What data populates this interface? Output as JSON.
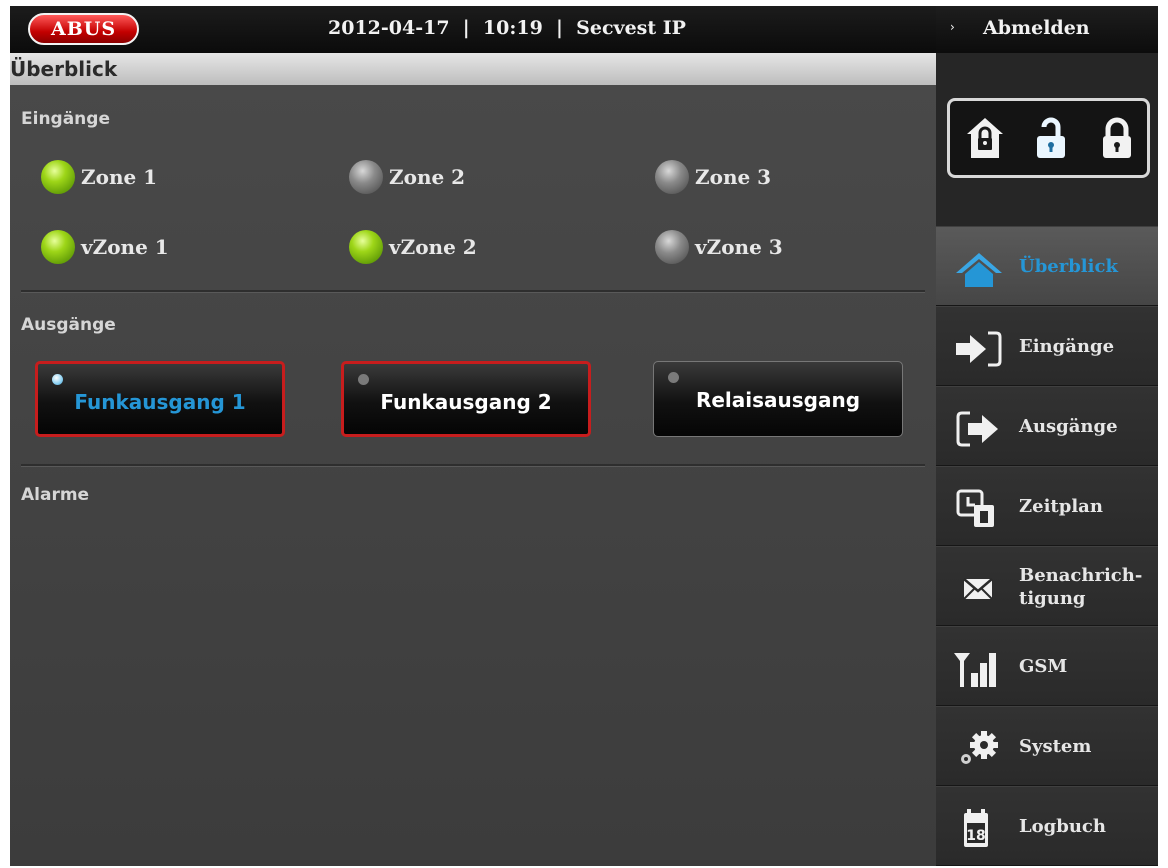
{
  "header": {
    "logo_text": "ABUS",
    "info": "2012-04-17  |  10:19  |  Secvest IP",
    "logout_label": "Abmelden",
    "logout_arrow": "›"
  },
  "page_title": "Überblick",
  "inputs": {
    "title": "Eingänge",
    "zones": [
      {
        "label": "Zone 1",
        "state": "on"
      },
      {
        "label": "Zone 2",
        "state": "off"
      },
      {
        "label": "Zone 3",
        "state": "off"
      },
      {
        "label": "vZone 1",
        "state": "on"
      },
      {
        "label": "vZone 2",
        "state": "on"
      },
      {
        "label": "vZone 3",
        "state": "off"
      }
    ]
  },
  "outputs": {
    "title": "Ausgänge",
    "buttons": [
      {
        "label": "Funkausgang 1",
        "selected": true,
        "active": true
      },
      {
        "label": "Funkausgang 2",
        "selected": true,
        "active": false
      },
      {
        "label": "Relaisausgang",
        "selected": false,
        "active": false
      }
    ]
  },
  "alarms": {
    "title": "Alarme"
  },
  "arm_modes": [
    {
      "name": "home-lock-icon",
      "active": false
    },
    {
      "name": "unlock-icon",
      "active": true
    },
    {
      "name": "lock-icon",
      "active": false
    }
  ],
  "sidebar": {
    "items": [
      {
        "label": "Überblick",
        "icon": "home-icon",
        "active": true
      },
      {
        "label": "Eingänge",
        "icon": "arrow-in-icon",
        "active": false
      },
      {
        "label": "Ausgänge",
        "icon": "arrow-out-icon",
        "active": false
      },
      {
        "label": "Zeitplan",
        "icon": "clock-calendar-icon",
        "active": false
      },
      {
        "label": "Benachrich-\ntigung",
        "icon": "envelope-icon",
        "active": false
      },
      {
        "label": "GSM",
        "icon": "signal-icon",
        "active": false
      },
      {
        "label": "System",
        "icon": "gears-icon",
        "active": false
      },
      {
        "label": "Logbuch",
        "icon": "calendar-icon",
        "active": false
      }
    ]
  },
  "colors": {
    "accent": "#2596d6",
    "led_on": "#8bc71b",
    "selected_border": "#c71d1d",
    "background": "#404040"
  }
}
